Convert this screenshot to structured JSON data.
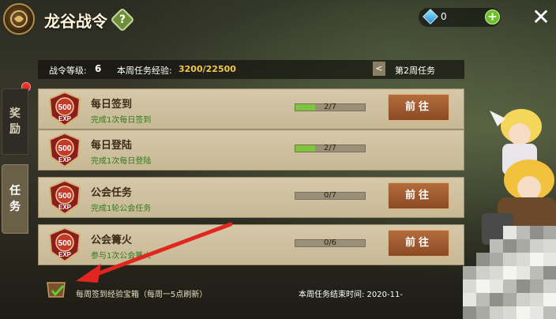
{
  "header": {
    "title": "龙谷战令",
    "help_glyph": "?",
    "gems": "0",
    "close_glyph": "✕",
    "plus_glyph": "+"
  },
  "side_tabs": {
    "reward": "奖\n励",
    "task": "任\n务"
  },
  "info": {
    "level_label": "战令等级:",
    "level_value": "6",
    "exp_label": "本周任务经验:",
    "exp_value": "3200/22500",
    "week_arrow": "<",
    "week_label": "第2周任务"
  },
  "tasks": [
    {
      "name": "每日签到",
      "desc": "完成1次每日签到",
      "progress_text": "2/7",
      "progress": 0.2857,
      "button": "前往",
      "exp": "500",
      "exp_unit": "EXP"
    },
    {
      "name": "每日登陆",
      "desc": "完成1次每日登陆",
      "progress_text": "2/7",
      "progress": 0.2857,
      "button": "",
      "exp": "500",
      "exp_unit": "EXP"
    },
    {
      "name": "公会任务",
      "desc": "完成1轮公会任务",
      "progress_text": "0/7",
      "progress": 0,
      "button": "前往",
      "exp": "500",
      "exp_unit": "EXP"
    },
    {
      "name": "公会篝火",
      "desc": "参与1次公会篝火",
      "progress_text": "0/6",
      "progress": 0,
      "button": "前往",
      "exp": "500",
      "exp_unit": "EXP"
    }
  ],
  "footer": {
    "chest_text": "每周签到经验宝箱（每周一5点刷新）",
    "end_text": "本周任务结束时间: 2020-11-"
  },
  "colors": {
    "accent_gold": "#f2c84a",
    "task_desc_green": "#2f7a1c",
    "progress_green": "#7ec43e",
    "button_brown": "#a0582e",
    "arrow_red": "#e0261e"
  }
}
